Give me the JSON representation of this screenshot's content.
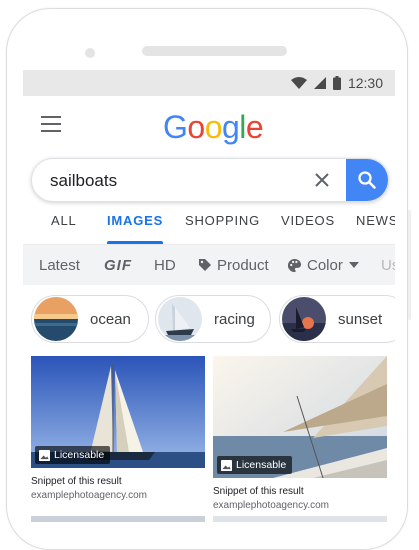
{
  "status_bar": {
    "time": "12:30"
  },
  "logo": {
    "letters": [
      "G",
      "o",
      "o",
      "g",
      "l",
      "e"
    ],
    "colors": [
      "#4285f4",
      "#ea4335",
      "#fbbc05",
      "#4285f4",
      "#34a853",
      "#ea4335"
    ]
  },
  "search": {
    "query": "sailboats"
  },
  "tabs": [
    {
      "label": "ALL",
      "active": false
    },
    {
      "label": "IMAGES",
      "active": true
    },
    {
      "label": "SHOPPING",
      "active": false
    },
    {
      "label": "VIDEOS",
      "active": false
    },
    {
      "label": "NEWS",
      "active": false
    }
  ],
  "filters": [
    {
      "label": "Latest"
    },
    {
      "label": "GIF"
    },
    {
      "label": "HD"
    },
    {
      "label": "Product",
      "icon": "tag-icon"
    },
    {
      "label": "Color",
      "icon": "palette-icon",
      "dropdown": true
    },
    {
      "label": "Us"
    }
  ],
  "chips": [
    {
      "label": "ocean",
      "icon": "ocean-thumbnail"
    },
    {
      "label": "racing",
      "icon": "racing-thumbnail"
    },
    {
      "label": "sunset",
      "icon": "sunset-thumbnail"
    }
  ],
  "results": [
    {
      "badge": "Licensable",
      "snippet": "Snippet of this result",
      "source": "examplephotoagency.com"
    },
    {
      "badge": "Licensable",
      "snippet": "Snippet of this result",
      "source": "examplephotoagency.com"
    }
  ],
  "colors": {
    "accent": "#1a73e8",
    "search_button": "#4285f4",
    "filter_bar": "#f1f3f4"
  }
}
